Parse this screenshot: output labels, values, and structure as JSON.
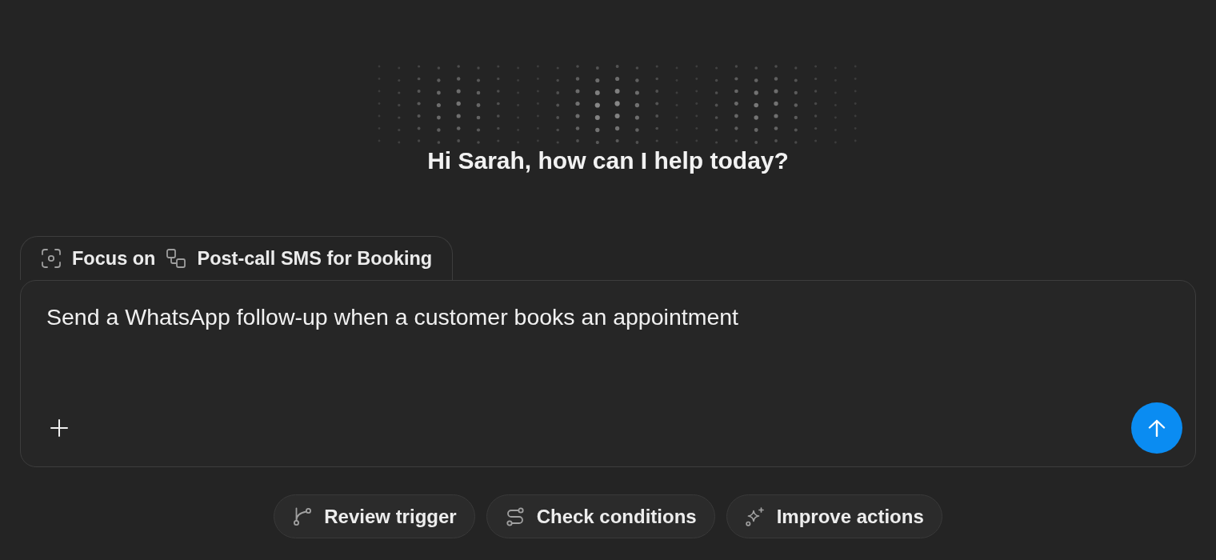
{
  "greeting": "Hi Sarah, how can I help today?",
  "focus": {
    "label": "Focus on",
    "target": "Post-call SMS for Booking"
  },
  "composer": {
    "value": "Send a WhatsApp follow-up when a customer books an appointment"
  },
  "suggestions": [
    {
      "label": "Review trigger",
      "kind": "branch"
    },
    {
      "label": "Check conditions",
      "kind": "route"
    },
    {
      "label": "Improve actions",
      "kind": "sparkle"
    }
  ]
}
